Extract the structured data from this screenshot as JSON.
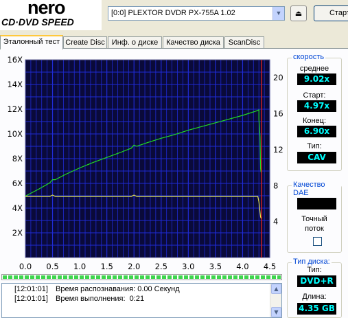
{
  "logo": {
    "brand": "nero",
    "product": "CD·DVD SPEED"
  },
  "header": {
    "drive_selector": "[0:0]  PLEXTOR DVDR   PX-755A 1.02",
    "dropdown_glyph": "▼",
    "eject_glyph": "⏏",
    "start_label": "Старт"
  },
  "tabs": [
    {
      "label": "Эталонный тест",
      "active": true
    },
    {
      "label": "Create Disc",
      "active": false
    },
    {
      "label": "Инф. о диске",
      "active": false
    },
    {
      "label": "Качество диска",
      "active": false
    },
    {
      "label": "ScanDisc",
      "active": false
    }
  ],
  "speed_panel": {
    "title": "скорость",
    "avg_label": "среднее",
    "avg_value": "9.02x",
    "start_label": "Старт:",
    "start_value": "4.97x",
    "end_label": "Конец:",
    "end_value": "6.90x",
    "type_label": "Тип:",
    "type_value": "CAV"
  },
  "dae_panel": {
    "title": "Качество DAE",
    "value": "",
    "accurate_label_1": "Точный",
    "accurate_label_2": "поток",
    "accurate_checked": false
  },
  "disc_panel": {
    "title": "Тип диска:",
    "type_label": "Тип:",
    "type_value": "DVD+R",
    "length_label": "Длина:",
    "length_value": "4.35 GB"
  },
  "progress": {
    "fraction": 1.0
  },
  "log": [
    {
      "time": "[12:01:01]",
      "text": "Время распознавания: 0.00 Секунд"
    },
    {
      "time": "[12:01:01]",
      "text": "Время выполнения:  0:21"
    }
  ],
  "colors": {
    "plot_bg": "#0a0a3a",
    "grid": "#1f2bd6",
    "speed_curve": "#22dd22",
    "rpm_curve": "#e8e84a",
    "end_marker": "#cc2222"
  },
  "chart_data": {
    "type": "line",
    "title": "",
    "xlabel": "",
    "ylabel": "",
    "xlim": [
      0,
      4.5
    ],
    "ylim": [
      0,
      16
    ],
    "y2lim": [
      0,
      22
    ],
    "x_ticks": [
      "0.0",
      "0.5",
      "1.0",
      "1.5",
      "2.0",
      "2.5",
      "3.0",
      "3.5",
      "4.0",
      "4.5"
    ],
    "y_ticks": [
      "2X",
      "4X",
      "6X",
      "8X",
      "10X",
      "12X",
      "14X",
      "16X"
    ],
    "y2_ticks": [
      "4",
      "8",
      "12",
      "16",
      "20"
    ],
    "end_marker_x": 4.35,
    "series": [
      {
        "axis": "left",
        "color_key": "speed_curve",
        "points": [
          [
            0,
            4.97
          ],
          [
            0.25,
            5.55
          ],
          [
            0.45,
            6.05
          ],
          [
            0.5,
            6.3
          ],
          [
            0.55,
            6.3
          ],
          [
            0.75,
            6.75
          ],
          [
            1.0,
            7.25
          ],
          [
            1.25,
            7.7
          ],
          [
            1.5,
            8.1
          ],
          [
            1.75,
            8.5
          ],
          [
            1.95,
            8.85
          ],
          [
            2.0,
            9.1
          ],
          [
            2.05,
            9.0
          ],
          [
            2.25,
            9.3
          ],
          [
            2.5,
            9.65
          ],
          [
            2.75,
            9.95
          ],
          [
            3.0,
            10.3
          ],
          [
            3.25,
            10.6
          ],
          [
            3.5,
            10.9
          ],
          [
            3.75,
            11.2
          ],
          [
            4.0,
            11.5
          ],
          [
            4.25,
            11.85
          ],
          [
            4.3,
            11.95
          ],
          [
            4.3,
            11.2
          ],
          [
            4.32,
            9.8
          ],
          [
            4.33,
            7.2
          ],
          [
            4.34,
            6.9
          ]
        ]
      },
      {
        "axis": "right",
        "color_key": "rpm_curve",
        "points": [
          [
            0,
            6.8
          ],
          [
            0.45,
            6.8
          ],
          [
            0.5,
            6.95
          ],
          [
            0.55,
            6.8
          ],
          [
            1.95,
            6.8
          ],
          [
            2.0,
            6.95
          ],
          [
            2.05,
            6.8
          ],
          [
            4.28,
            6.8
          ],
          [
            4.3,
            6.2
          ],
          [
            4.33,
            4.5
          ],
          [
            4.35,
            4.3
          ]
        ]
      }
    ]
  }
}
